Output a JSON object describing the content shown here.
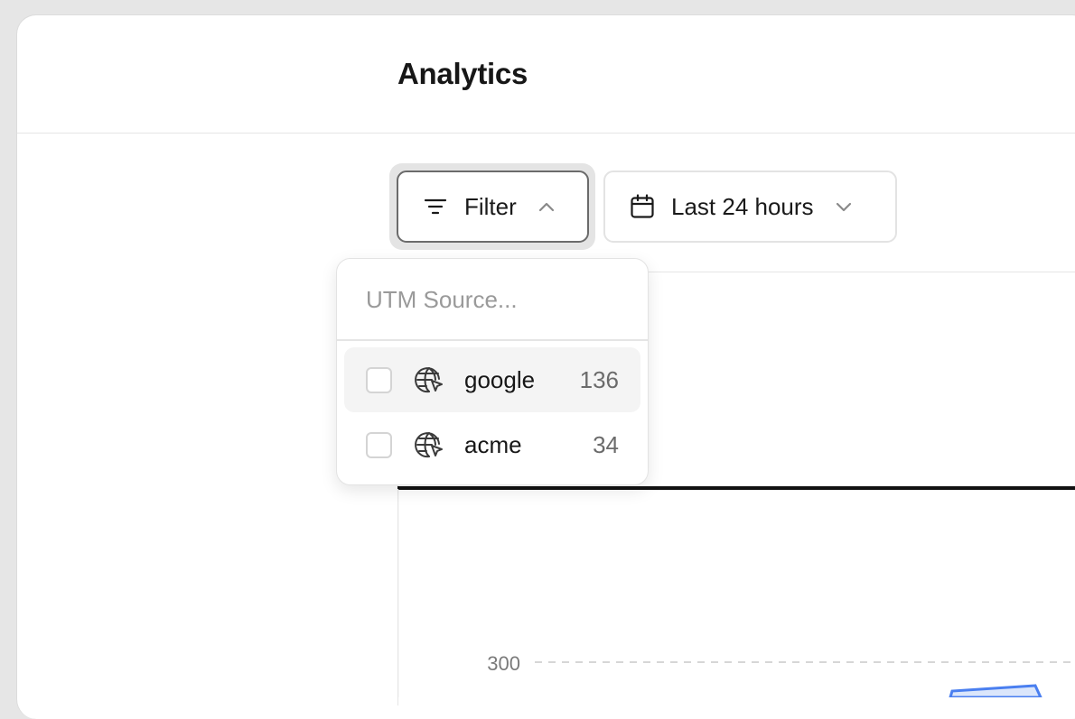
{
  "header": {
    "title": "Analytics"
  },
  "toolbar": {
    "filter_label": "Filter",
    "date_range_label": "Last 24 hours"
  },
  "filter_dropdown": {
    "search_placeholder": "UTM Source...",
    "options": [
      {
        "label": "google",
        "count": "136",
        "checked": false,
        "highlighted": true
      },
      {
        "label": "acme",
        "count": "34",
        "checked": false,
        "highlighted": false
      }
    ]
  },
  "chart": {
    "y_tick": "300"
  },
  "colors": {
    "accent_fill": "#dbe6fb",
    "accent_stroke": "#4a7ff0",
    "border_active": "#6b6b6b"
  }
}
